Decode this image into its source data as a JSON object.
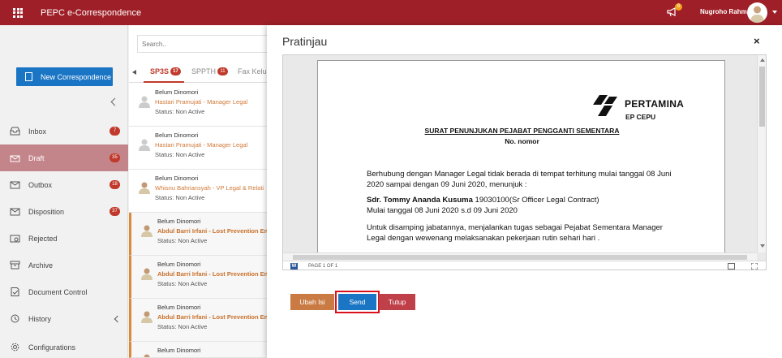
{
  "app": {
    "title": "PEPC e-Correspondence",
    "notif_count": "8",
    "user_name": "Nugroho Rahm"
  },
  "sidebar": {
    "new_button": "New Correspondence",
    "items": [
      {
        "label": "Inbox",
        "badge": "7"
      },
      {
        "label": "Draft",
        "badge": "35",
        "active": true
      },
      {
        "label": "Outbox",
        "badge": "18"
      },
      {
        "label": "Disposition",
        "badge": "37"
      },
      {
        "label": "Rejected",
        "badge": ""
      },
      {
        "label": "Archive",
        "badge": ""
      },
      {
        "label": "Document Control",
        "badge": ""
      },
      {
        "label": "History",
        "badge": ""
      },
      {
        "label": "Configurations",
        "badge": ""
      }
    ]
  },
  "list": {
    "search_placeholder": "Search..",
    "tabs": [
      {
        "label": "SP3S",
        "badge": "17"
      },
      {
        "label": "SPPTH",
        "badge": "11"
      },
      {
        "label": "Fax Keluar",
        "badge": ""
      }
    ],
    "items": [
      {
        "status_line": "Belum Dinomori",
        "from": "Hastari Pramujati - Manager Legal",
        "status": "Status: Non Active"
      },
      {
        "status_line": "Belum Dinomori",
        "from": "Hastari Pramujati - Manager Legal",
        "status": "Status: Non Active"
      },
      {
        "status_line": "Belum Dinomori",
        "from": "Whisnu Bahriansyah - VP Legal & Relati",
        "status": "Status: Non Active"
      },
      {
        "status_line": "Belum Dinomori",
        "from": "Abdul Barri Irfani - Lost Prevention Eng",
        "status": "Status: Non Active"
      },
      {
        "status_line": "Belum Dinomori",
        "from": "Abdul Barri Irfani - Lost Prevention Eng",
        "status": "Status: Non Active"
      },
      {
        "status_line": "Belum Dinomori",
        "from": "Abdul Barri Irfani - Lost Prevention Eng",
        "status": "Status: Non Active"
      },
      {
        "status_line": "Belum Dinomori",
        "from": "",
        "status": ""
      }
    ]
  },
  "modal": {
    "title": "Pratinjau",
    "close": "×",
    "document": {
      "company": "PERTAMINA",
      "unit": "EP CEPU",
      "heading": "SURAT PENUNJUKAN PEJABAT PENGGANTI SEMENTARA",
      "number": "No. nomor",
      "para1_line1": "Berhubung dengan Manager Legal tidak berada di tempat terhitung mulai tanggal 08 Juni",
      "para1_line2": "2020 sampai dengan 09 Juni 2020, menunjuk :",
      "appointee_name": "Sdr. Tommy Ananda Kusuma",
      "appointee_detail": " 19030100(Sr Officer Legal Contract)",
      "period": "Mulai tanggal 08 Juni 2020 s.d 09 Juni 2020",
      "para2_line1": "Untuk disamping jabatannya, menjalankan tugas sebagai Pejabat Sementara Manager",
      "para2_line2": "Legal dengan wewenang melaksanakan pekerjaan rutin sehari hari ."
    },
    "page_info": "PAGE 1 OF 1",
    "buttons": {
      "edit": "Ubah Isi",
      "send": "Send",
      "close": "Tutup"
    }
  },
  "colors": {
    "brand": "#9e1f27",
    "primary": "#1a75c4",
    "edit": "#c97b43",
    "danger": "#c0404a",
    "highlight": "#d9111b"
  }
}
